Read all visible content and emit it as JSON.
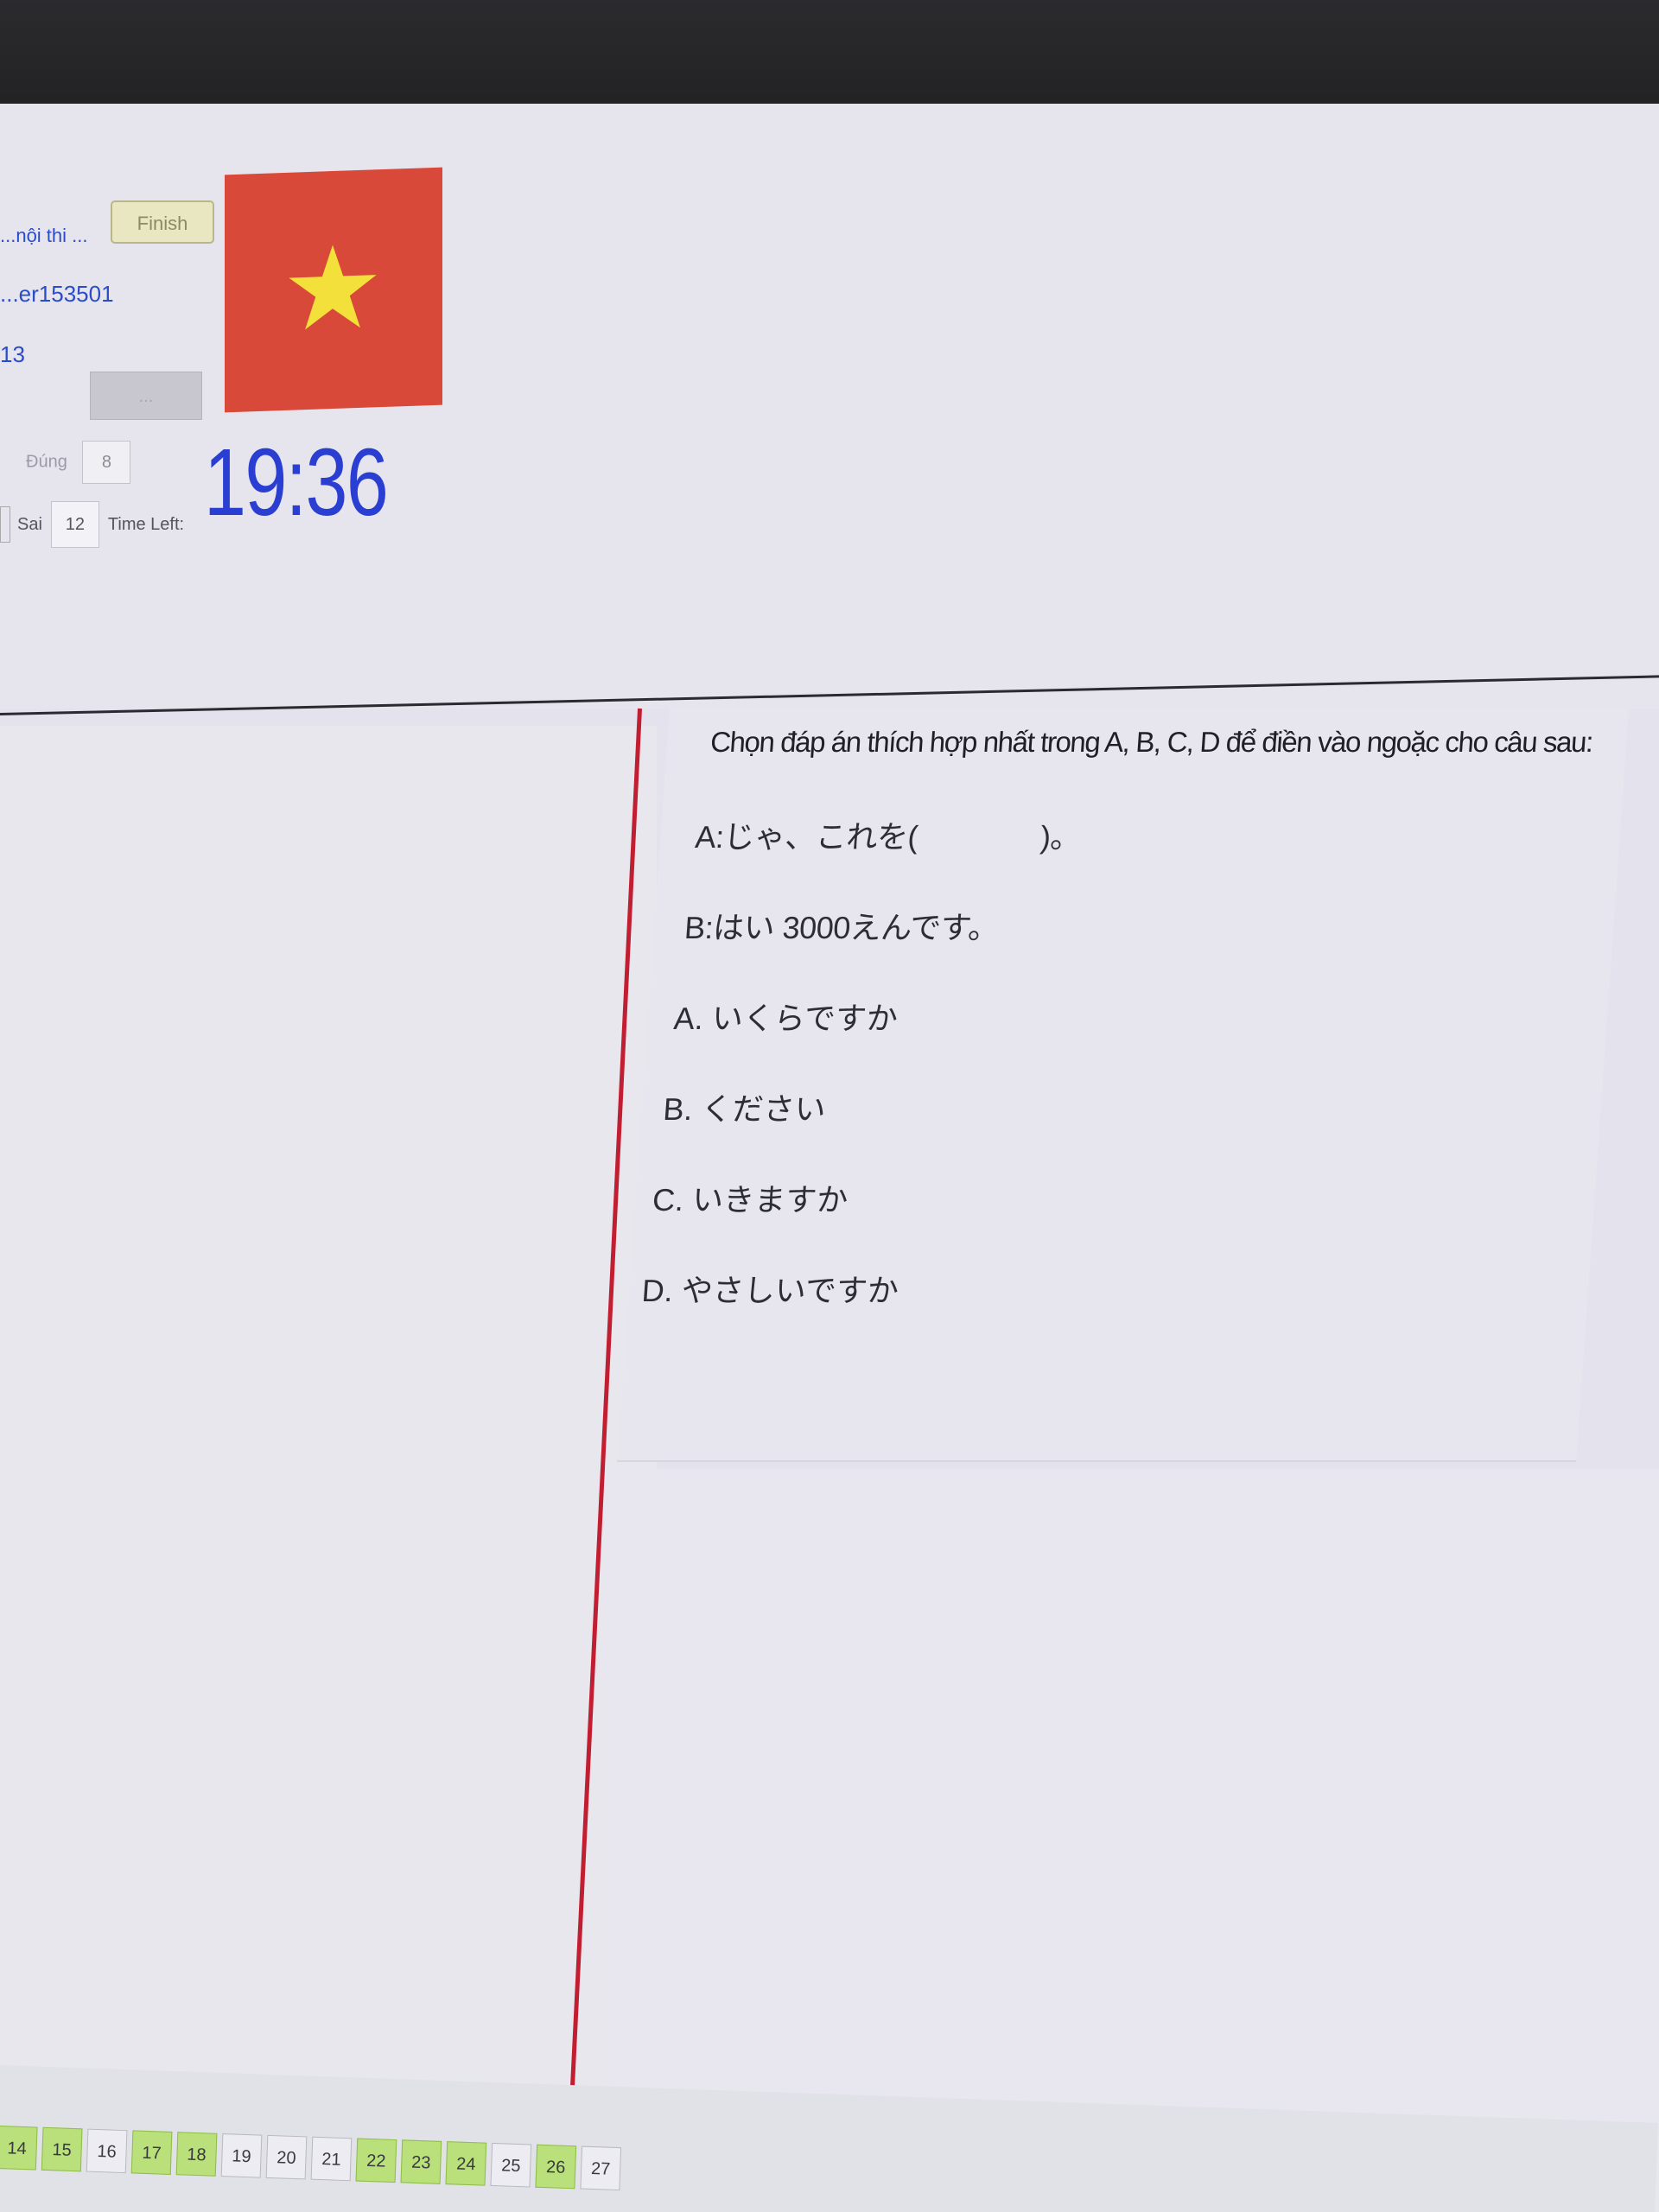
{
  "header": {
    "exam_link": "...nội thi ...",
    "candidate_id": "...er153501",
    "seat_no": "13",
    "finish_button": "Finish",
    "disabled_button": "...",
    "dung_label": "Đúng",
    "dung_value": "8",
    "sai_label": "Sai",
    "sai_value": "12",
    "time_left_label": "Time Left:",
    "timer": "19:36",
    "flag_colors": {
      "field": "#d8493a",
      "star": "#f3e03a"
    }
  },
  "question": {
    "instruction": "Chọn đáp án thích hợp nhất trong A, B, C, D để điền vào ngoặc cho câu sau:",
    "line_a": "A:じゃ、これを(　　　　)。",
    "line_b": "B:はい 3000えんです。",
    "options": [
      {
        "key": "A.",
        "text": "いくらですか"
      },
      {
        "key": "B.",
        "text": "ください"
      },
      {
        "key": "C.",
        "text": "いきますか"
      },
      {
        "key": "D.",
        "text": "やさしいですか"
      }
    ]
  },
  "navigator": {
    "items": [
      {
        "n": "14",
        "answered": true
      },
      {
        "n": "15",
        "answered": true
      },
      {
        "n": "16",
        "answered": false
      },
      {
        "n": "17",
        "answered": true
      },
      {
        "n": "18",
        "answered": true
      },
      {
        "n": "19",
        "answered": false
      },
      {
        "n": "20",
        "answered": false
      },
      {
        "n": "21",
        "answered": false
      },
      {
        "n": "22",
        "answered": true
      },
      {
        "n": "23",
        "answered": true
      },
      {
        "n": "24",
        "answered": true
      },
      {
        "n": "25",
        "answered": false
      },
      {
        "n": "26",
        "answered": true
      },
      {
        "n": "27",
        "answered": false
      }
    ]
  }
}
